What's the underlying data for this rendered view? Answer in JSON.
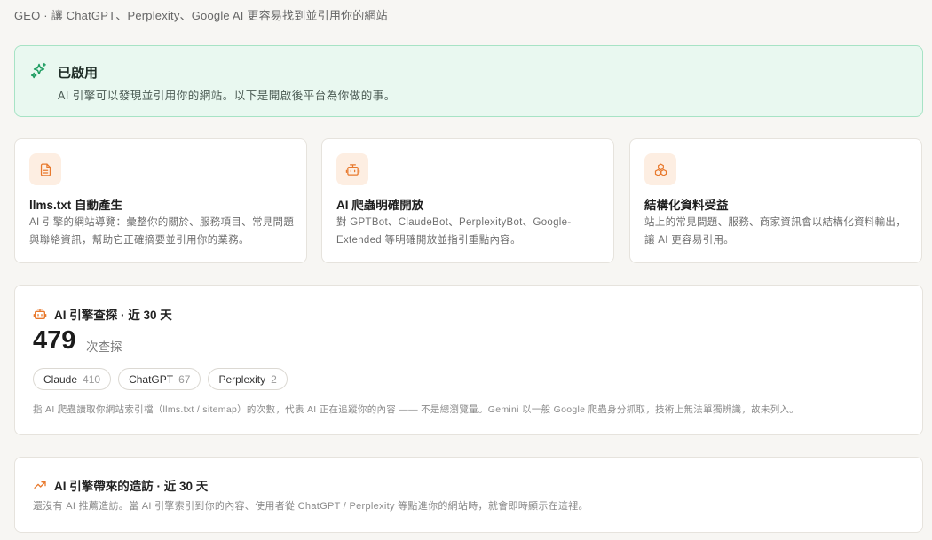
{
  "header": {
    "title": "GEO · 讓 ChatGPT、Perplexity、Google AI 更容易找到並引用你的網站"
  },
  "banner": {
    "title": "已啟用",
    "desc": "AI 引擎可以發現並引用你的網站。以下是開啟後平台為你做的事。",
    "icon": "sparkles-icon",
    "accent": "#2bb673"
  },
  "features": [
    {
      "icon": "document-icon",
      "title": "llms.txt 自動產生",
      "desc": "AI 引擎的網站導覽：彙整你的關於、服務項目、常見問題與聯絡資訊，幫助它正確摘要並引用你的業務。"
    },
    {
      "icon": "robot-icon",
      "title": "AI 爬蟲明確開放",
      "desc": "對 GPTBot、ClaudeBot、PerplexityBot、Google-Extended 等明確開放並指引重點內容。"
    },
    {
      "icon": "boxes-icon",
      "title": "結構化資料受益",
      "desc": "站上的常見問題、服務、商家資訊會以結構化資料輸出，讓 AI 更容易引用。"
    }
  ],
  "crawl_stats": {
    "title": "AI 引擎查探 · 近 30 天",
    "total": "479",
    "unit": "次查探",
    "bots": [
      {
        "name": "Claude",
        "count": "410"
      },
      {
        "name": "ChatGPT",
        "count": "67"
      },
      {
        "name": "Perplexity",
        "count": "2"
      }
    ],
    "note": "指 AI 爬蟲讀取你網站索引檔（llms.txt / sitemap）的次數，代表 AI 正在追蹤你的內容 —— 不是總瀏覽量。Gemini 以一般 Google 爬蟲身分抓取，技術上無法單獨辨識，故未列入。"
  },
  "visits": {
    "title": "AI 引擎帶來的造訪 · 近 30 天",
    "note": "還沒有 AI 推薦造訪。當 AI 引擎索引到你的內容、使用者從 ChatGPT / Perplexity 等點進你的網站時，就會即時顯示在這裡。"
  },
  "colors": {
    "accent_orange": "#e8792d",
    "banner_bg": "#e9f8f0",
    "banner_border": "#a7e3c5"
  }
}
